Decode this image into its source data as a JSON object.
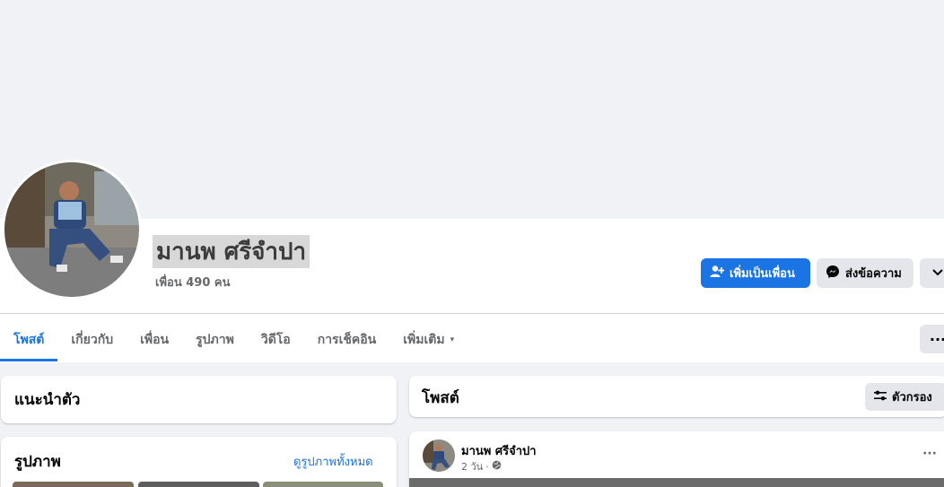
{
  "profile": {
    "name": "มานพ ศรีจำปา",
    "friends_count_text": "เพื่อน 490 คน"
  },
  "actions": {
    "add_friend": "เพิ่มเป็นเพื่อน",
    "message": "ส่งข้อความ",
    "add_friend_icon": "person-add-icon",
    "message_icon": "messenger-icon",
    "more_icon": "chevron-down-icon"
  },
  "tabs": [
    {
      "label": "โพสต์",
      "active": true
    },
    {
      "label": "เกี่ยวกับ"
    },
    {
      "label": "เพื่อน"
    },
    {
      "label": "รูปภาพ"
    },
    {
      "label": "วิดีโอ"
    },
    {
      "label": "การเช็คอิน"
    },
    {
      "label": "เพิ่มเติม",
      "caret": "▾"
    }
  ],
  "tab_more": "···",
  "intro": {
    "title": "แนะนำตัว"
  },
  "photos": {
    "title": "รูปภาพ",
    "see_all": "ดูรูปภาพทั้งหมด"
  },
  "posts": {
    "title": "โพสต์",
    "filter_label": "ตัวกรอง",
    "filter_icon": "sliders-icon"
  },
  "post": {
    "author": "มานพ ศรีจำปา",
    "time": "2 วัน",
    "separator": "·",
    "audience_icon": "globe-icon",
    "menu": "···"
  },
  "colors": {
    "accent": "#1b74e4",
    "background": "#f0f2f5",
    "secondary_button": "#e4e6eb"
  }
}
